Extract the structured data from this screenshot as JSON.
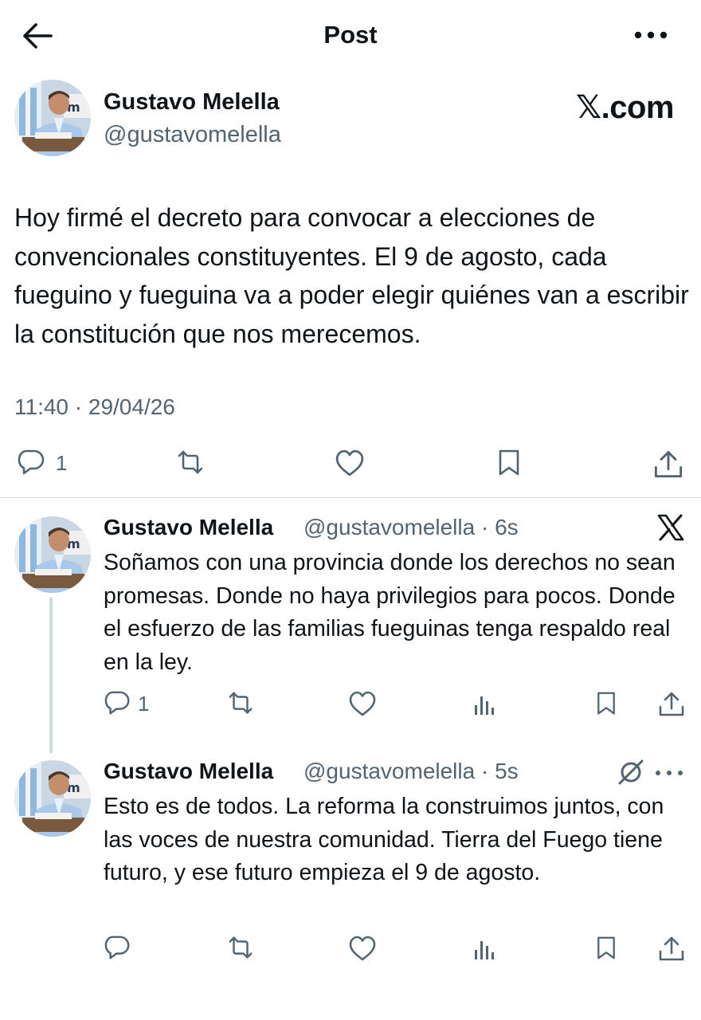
{
  "header": {
    "title": "Post",
    "back_icon": "arrow-left-icon",
    "more_icon": "more-horizontal-icon"
  },
  "main_post": {
    "author_name": "Gustavo Melella",
    "author_handle": "@gustavomelella",
    "brand": "𝕏.com",
    "text": "Hoy firmé el decreto para convocar a elecciones de convencionales constituyentes. El 9 de agosto, cada fueguino y fueguina va a poder elegir quiénes van a escribir la constitución que nos merecemos.",
    "timestamp": "11:40 · 29/04/26",
    "actions": {
      "reply_count": "1"
    }
  },
  "replies": [
    {
      "author_name": "Gustavo Melella",
      "author_handle": "@gustavomelella · 6s",
      "text": "Soñamos con una provincia donde los derechos no sean promesas. Donde no haya privilegios para pocos. Donde el esfuerzo de las familias fueguinas tenga respaldo real en la ley.",
      "reply_count": "1"
    },
    {
      "author_name": "Gustavo Melella",
      "author_handle": "@gustavomelella · 5s",
      "text": "Esto es de todos. La reforma la construimos juntos, con las voces de nuestra comunidad. Tierra del Fuego tiene futuro, y ese futuro empieza el 9 de agosto.",
      "reply_count": ""
    }
  ],
  "colors": {
    "text": "#0f1419",
    "secondary": "#536471",
    "divider": "#cfd9de"
  }
}
